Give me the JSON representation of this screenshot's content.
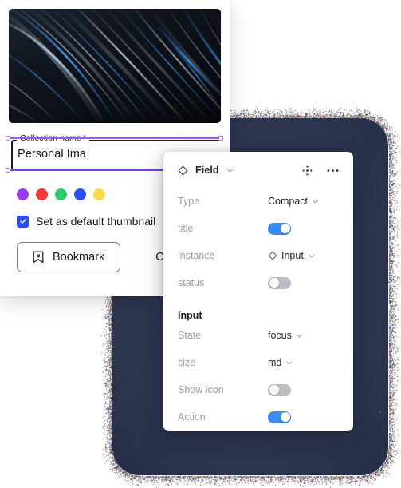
{
  "colors": {
    "toggle_on": "#3B8AF0",
    "toggle_off": "#b9bec4",
    "checkbox": "#2B4EEC",
    "selection_purple": "#9A5CF5",
    "required_red": "#e5484d",
    "backdrop_dark": "#262e49"
  },
  "collection_dialog": {
    "preview_image_alt": "abstract-blue-light-streaks-image",
    "name_field": {
      "legend": "Collection name",
      "required_marker": "*",
      "value": "Personal Ima",
      "placeholder": "Collection name"
    },
    "color_swatches": [
      {
        "name": "purple",
        "hex": "#9A3AF0"
      },
      {
        "name": "red",
        "hex": "#F4383C"
      },
      {
        "name": "green",
        "hex": "#2ECC71"
      },
      {
        "name": "blue",
        "hex": "#2D4EF5"
      },
      {
        "name": "yellow",
        "hex": "#FBD94B"
      }
    ],
    "thumbnail_checkbox": {
      "label": "Set as default thumbnail",
      "checked": true
    },
    "buttons": {
      "bookmark": "Bookmark",
      "cancel": "Ca"
    }
  },
  "field_panel": {
    "header": {
      "title": "Field",
      "icons": {
        "type": "diamond-icon",
        "chevron": "chevron-down-icon",
        "move": "move-icon",
        "more": "more-options-icon"
      }
    },
    "properties": [
      {
        "label": "Type",
        "control": "select",
        "value": "Compact"
      },
      {
        "label": "title",
        "control": "toggle",
        "value": true
      },
      {
        "label": "instance",
        "control": "select-icon",
        "value": "Input"
      },
      {
        "label": "status",
        "control": "toggle",
        "value": false
      }
    ],
    "section": {
      "title": "Input",
      "properties": [
        {
          "label": "State",
          "control": "select",
          "value": "focus"
        },
        {
          "label": "size",
          "control": "select",
          "value": "md"
        },
        {
          "label": "Show icon",
          "control": "toggle",
          "value": false
        },
        {
          "label": "Action",
          "control": "toggle",
          "value": true
        }
      ]
    }
  }
}
